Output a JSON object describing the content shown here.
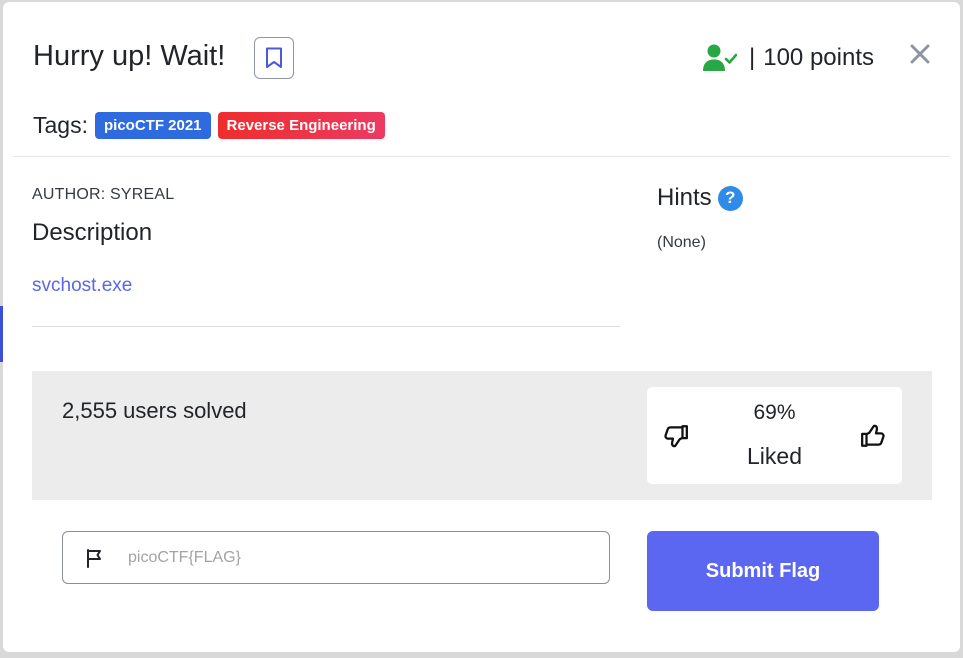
{
  "challenge": {
    "title": "Hurry up! Wait!",
    "points_separator": "|",
    "points_label": "100 points",
    "tags_label": "Tags:",
    "tags": [
      {
        "label": "picoCTF 2021",
        "color": "#2f6bdf"
      },
      {
        "label": "Reverse Engineering",
        "color": "#ee2d2d"
      }
    ]
  },
  "description": {
    "author": "AUTHOR: SYREAL",
    "heading": "Description",
    "file_link": "svchost.exe"
  },
  "hints": {
    "heading": "Hints",
    "help_glyph": "?",
    "value": "(None)"
  },
  "stats": {
    "solved_text": "2,555 users solved",
    "liked_percent": "69%",
    "liked_label": "Liked"
  },
  "submission": {
    "placeholder": "picoCTF{FLAG}",
    "value": "",
    "submit_label": "Submit Flag"
  },
  "icons": {
    "bookmark": "bookmark-icon",
    "solved_user": "user-check-icon",
    "close": "close-icon",
    "help": "question-circle-icon",
    "thumbs_down": "thumbs-down-icon",
    "thumbs_up": "thumbs-up-icon",
    "flag": "flag-icon"
  },
  "colors": {
    "accent": "#5b67f0",
    "solved_green": "#28a745",
    "link": "#5b67e8",
    "help_blue": "#2f8be8",
    "panel_gray": "#ececec"
  }
}
